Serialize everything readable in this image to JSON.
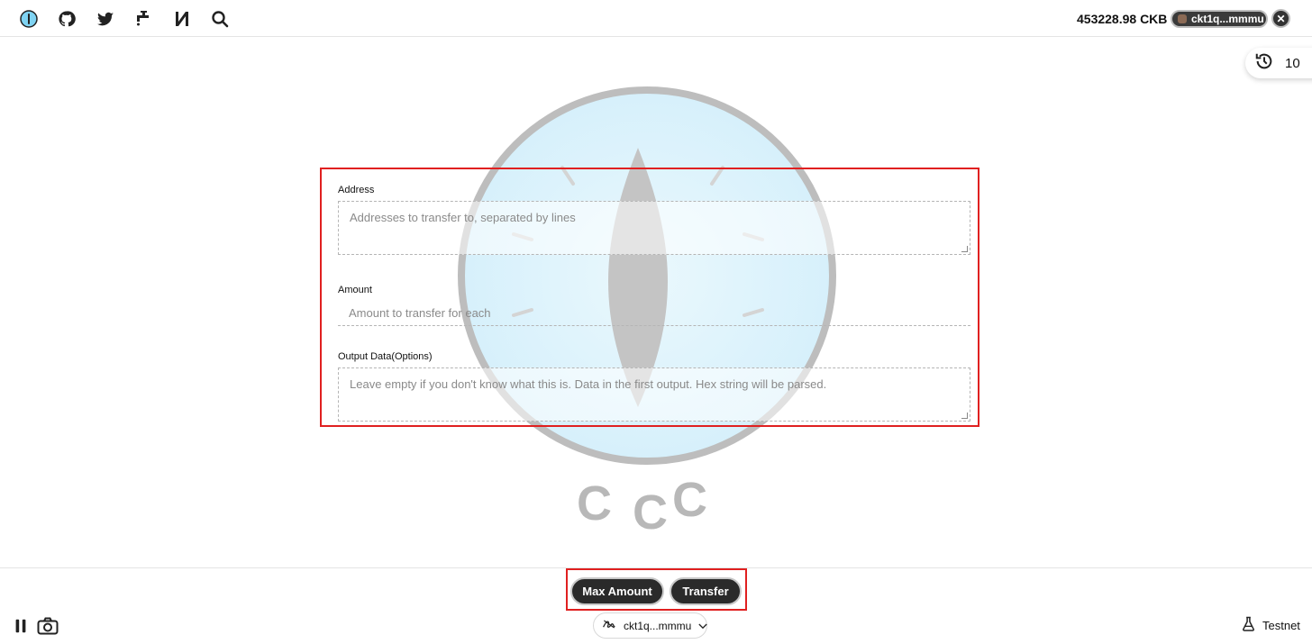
{
  "topbar": {
    "icons": [
      "ckb-logo-icon",
      "github-icon",
      "twitter-icon",
      "faucet-icon",
      "nervos-icon",
      "search-icon"
    ],
    "balance": "453228.98 CKB",
    "address": "ckt1q...mmmu",
    "close_label": "✕"
  },
  "history": {
    "count": "10"
  },
  "logo": {
    "letters": [
      "C",
      "C",
      "C"
    ]
  },
  "form": {
    "address_label": "Address",
    "address_placeholder": "Addresses to transfer to, separated by lines",
    "amount_label": "Amount",
    "amount_placeholder": "Amount to transfer for each",
    "output_label": "Output Data(Options)",
    "output_placeholder": "Leave empty if you don't know what this is. Data in the first output. Hex string will be parsed."
  },
  "actions": {
    "max_amount_label": "Max Amount",
    "transfer_label": "Transfer"
  },
  "bottom": {
    "signer_address": "ckt1q...mmmu",
    "network_label": "Testnet"
  },
  "colors": {
    "accent_red": "#e02020",
    "pill_dark": "#2a2a2a",
    "logo_blue": "#dff3fb",
    "logo_gray": "#bdbdbd"
  }
}
